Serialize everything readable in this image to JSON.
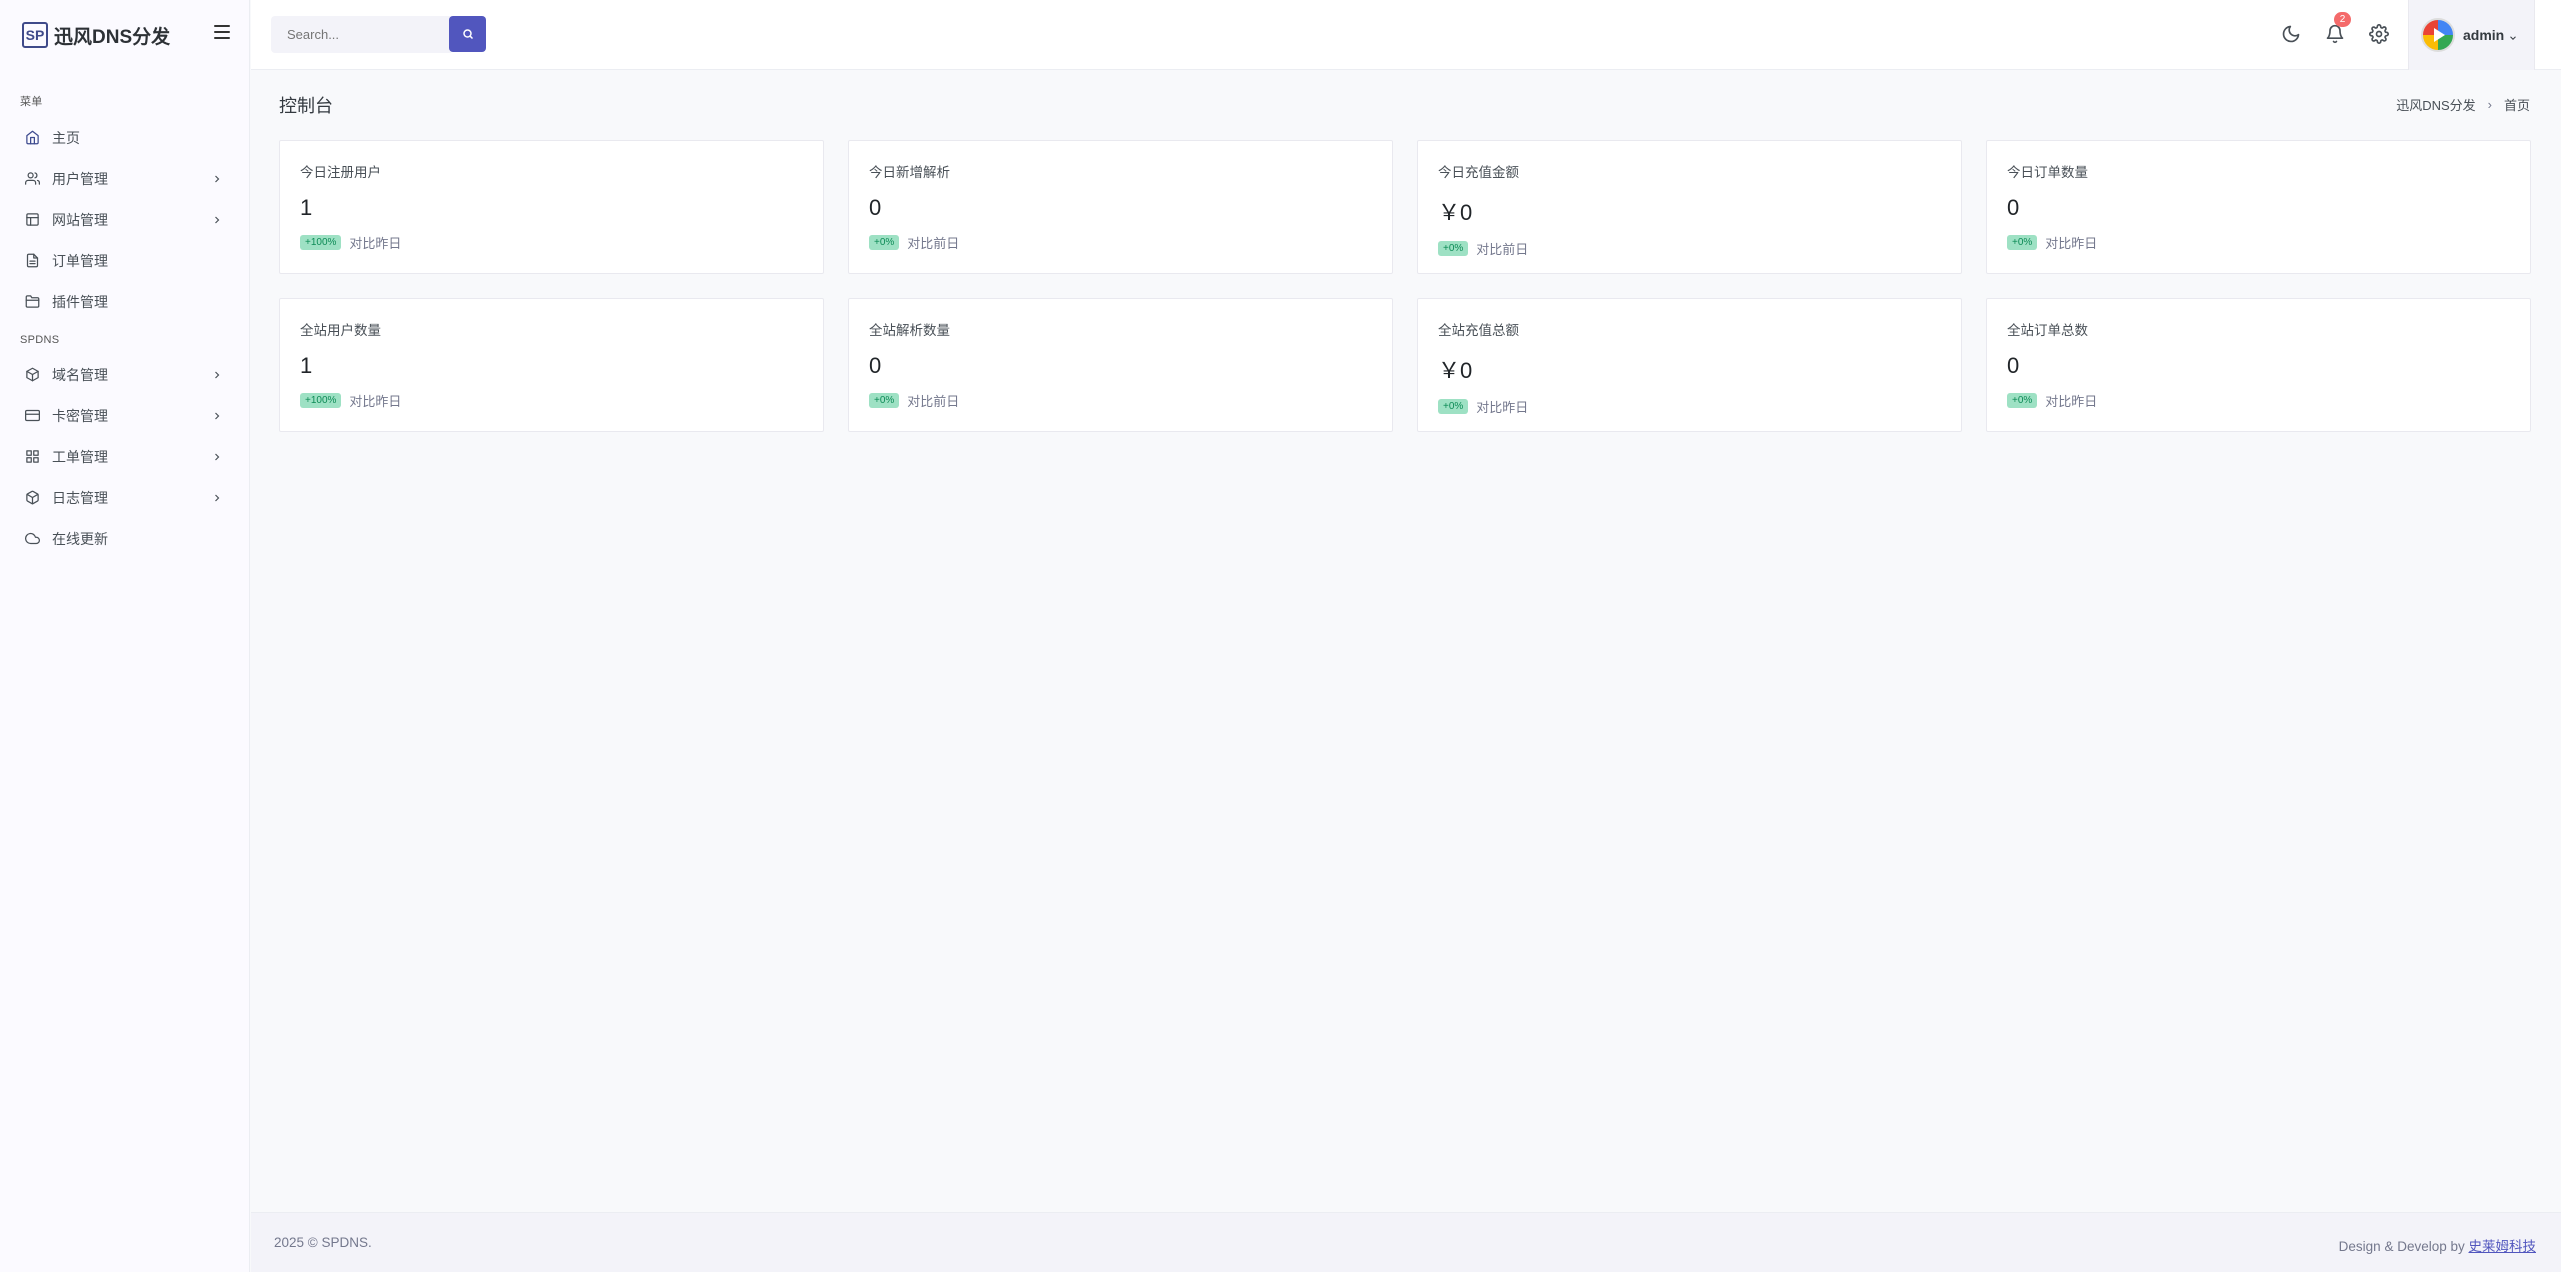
{
  "brand": {
    "logo": "SP",
    "name": "迅风DNS分发"
  },
  "sidebar": {
    "section1_title": "菜单",
    "section2_title": "SPDNS",
    "items": [
      {
        "label": "主页",
        "icon": "home-icon",
        "expandable": false
      },
      {
        "label": "用户管理",
        "icon": "users-icon",
        "expandable": true
      },
      {
        "label": "网站管理",
        "icon": "layout-icon",
        "expandable": true
      },
      {
        "label": "订单管理",
        "icon": "file-text-icon",
        "expandable": false
      },
      {
        "label": "插件管理",
        "icon": "folder-icon",
        "expandable": false
      },
      {
        "label": "域名管理",
        "icon": "globe-icon",
        "expandable": true
      },
      {
        "label": "卡密管理",
        "icon": "credit-card-icon",
        "expandable": true
      },
      {
        "label": "工单管理",
        "icon": "grid-icon",
        "expandable": true
      },
      {
        "label": "日志管理",
        "icon": "box-icon",
        "expandable": true
      },
      {
        "label": "在线更新",
        "icon": "cloud-icon",
        "expandable": false
      }
    ]
  },
  "topbar": {
    "search_placeholder": "Search...",
    "notification_count": "2",
    "user_name": "admin"
  },
  "page": {
    "title": "控制台",
    "breadcrumb": [
      "迅风DNS分发",
      "首页"
    ]
  },
  "cards": [
    {
      "label": "今日注册用户",
      "value": "1",
      "badge": "+100%",
      "compare": "对比昨日"
    },
    {
      "label": "今日新增解析",
      "value": "0",
      "badge": "+0%",
      "compare": "对比前日"
    },
    {
      "label": "今日充值金额",
      "value": "￥0",
      "badge": "+0%",
      "compare": "对比前日"
    },
    {
      "label": "今日订单数量",
      "value": "0",
      "badge": "+0%",
      "compare": "对比昨日"
    },
    {
      "label": "全站用户数量",
      "value": "1",
      "badge": "+100%",
      "compare": "对比昨日"
    },
    {
      "label": "全站解析数量",
      "value": "0",
      "badge": "+0%",
      "compare": "对比前日"
    },
    {
      "label": "全站充值总额",
      "value": "￥0",
      "badge": "+0%",
      "compare": "对比昨日"
    },
    {
      "label": "全站订单总数",
      "value": "0",
      "badge": "+0%",
      "compare": "对比昨日"
    }
  ],
  "footer": {
    "copyright": "2025 © SPDNS.",
    "design_prefix": "Design & Develop by ",
    "design_link": "史莱姆科技"
  },
  "colors": {
    "accent": "#5156be",
    "badge_bg": "#9ee1c4",
    "badge_text": "#0d8b56",
    "notification": "#f46a6a"
  }
}
